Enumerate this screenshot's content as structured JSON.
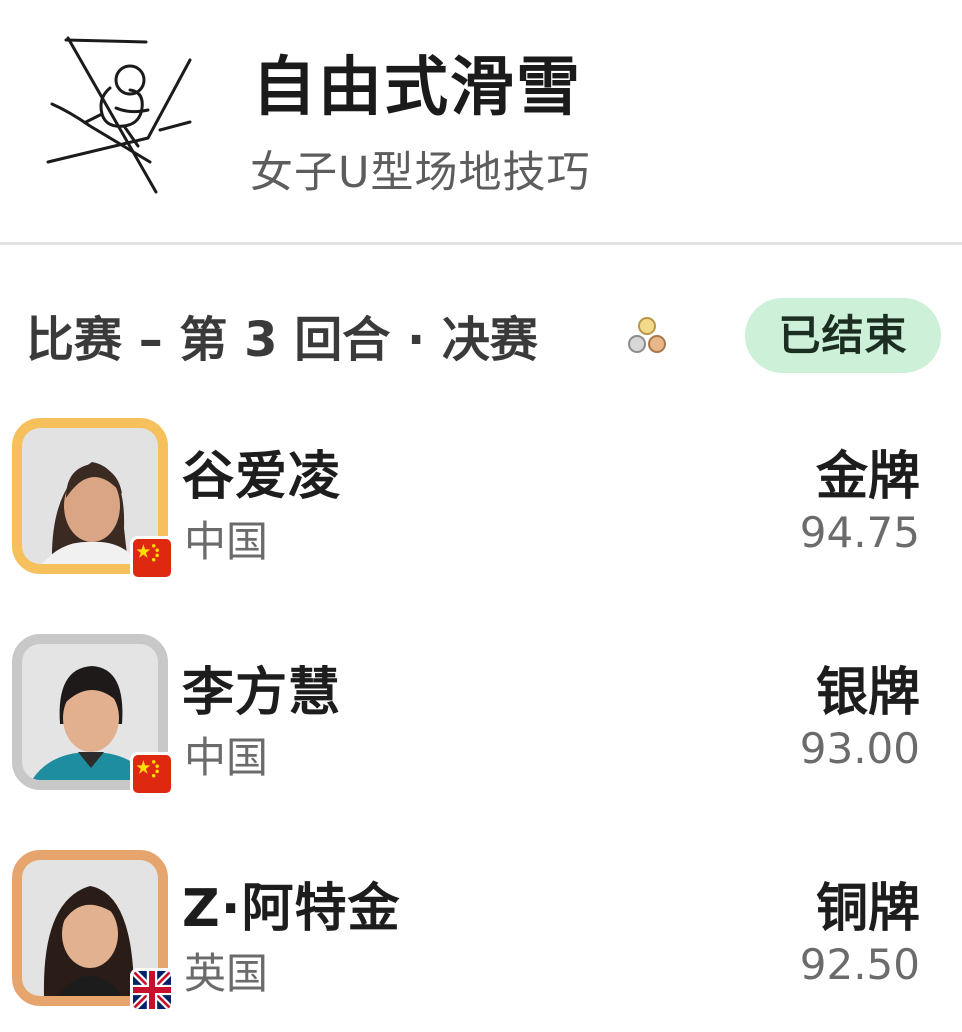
{
  "header": {
    "sport_icon": "freestyle-skiing-icon",
    "sport_title": "自由式滑雪",
    "event_name": "女子U型场地技巧"
  },
  "round": {
    "label": "比赛 – 第 3 回合 · 决赛",
    "medals_icon": "medals-icon",
    "status": "已结束",
    "status_bg": "#ccf0d8"
  },
  "athletes": [
    {
      "name": "谷爱凌",
      "country": "中国",
      "flag": "china-flag-icon",
      "medal": "金牌",
      "score": "94.75",
      "frame_color": "#f6c05c"
    },
    {
      "name": "李方慧",
      "country": "中国",
      "flag": "china-flag-icon",
      "medal": "银牌",
      "score": "93.00",
      "frame_color": "#c8c8c8"
    },
    {
      "name": "Z·阿特金",
      "country": "英国",
      "flag": "uk-flag-icon",
      "medal": "铜牌",
      "score": "92.50",
      "frame_color": "#e5a56d"
    }
  ]
}
